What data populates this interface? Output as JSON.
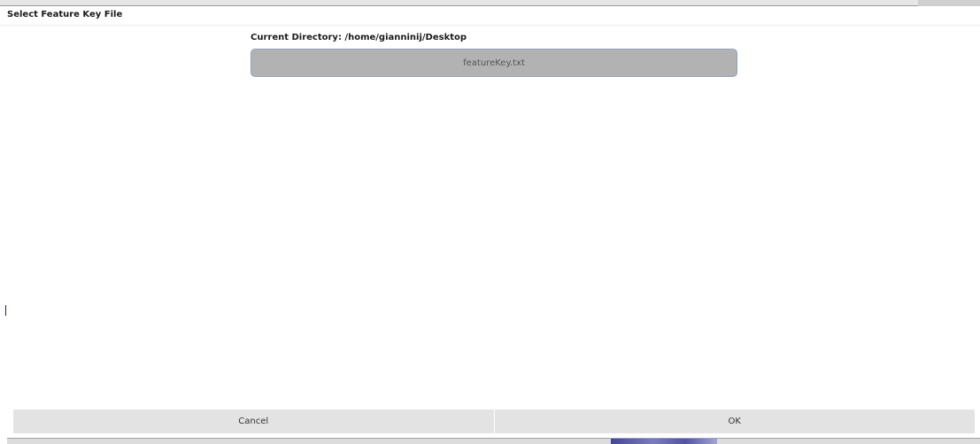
{
  "dialog": {
    "title": "Select Feature Key File",
    "current_directory_label": "Current Directory: /home/gianninij/Desktop"
  },
  "file_list": {
    "items": [
      {
        "name": "featureKey.txt"
      }
    ]
  },
  "buttons": {
    "cancel_label": "Cancel",
    "ok_label": "OK"
  },
  "colors": {
    "selected_item_bg": "#b2b2b2",
    "selected_item_border": "#8fa2c4",
    "button_bg": "#e3e3e3"
  }
}
